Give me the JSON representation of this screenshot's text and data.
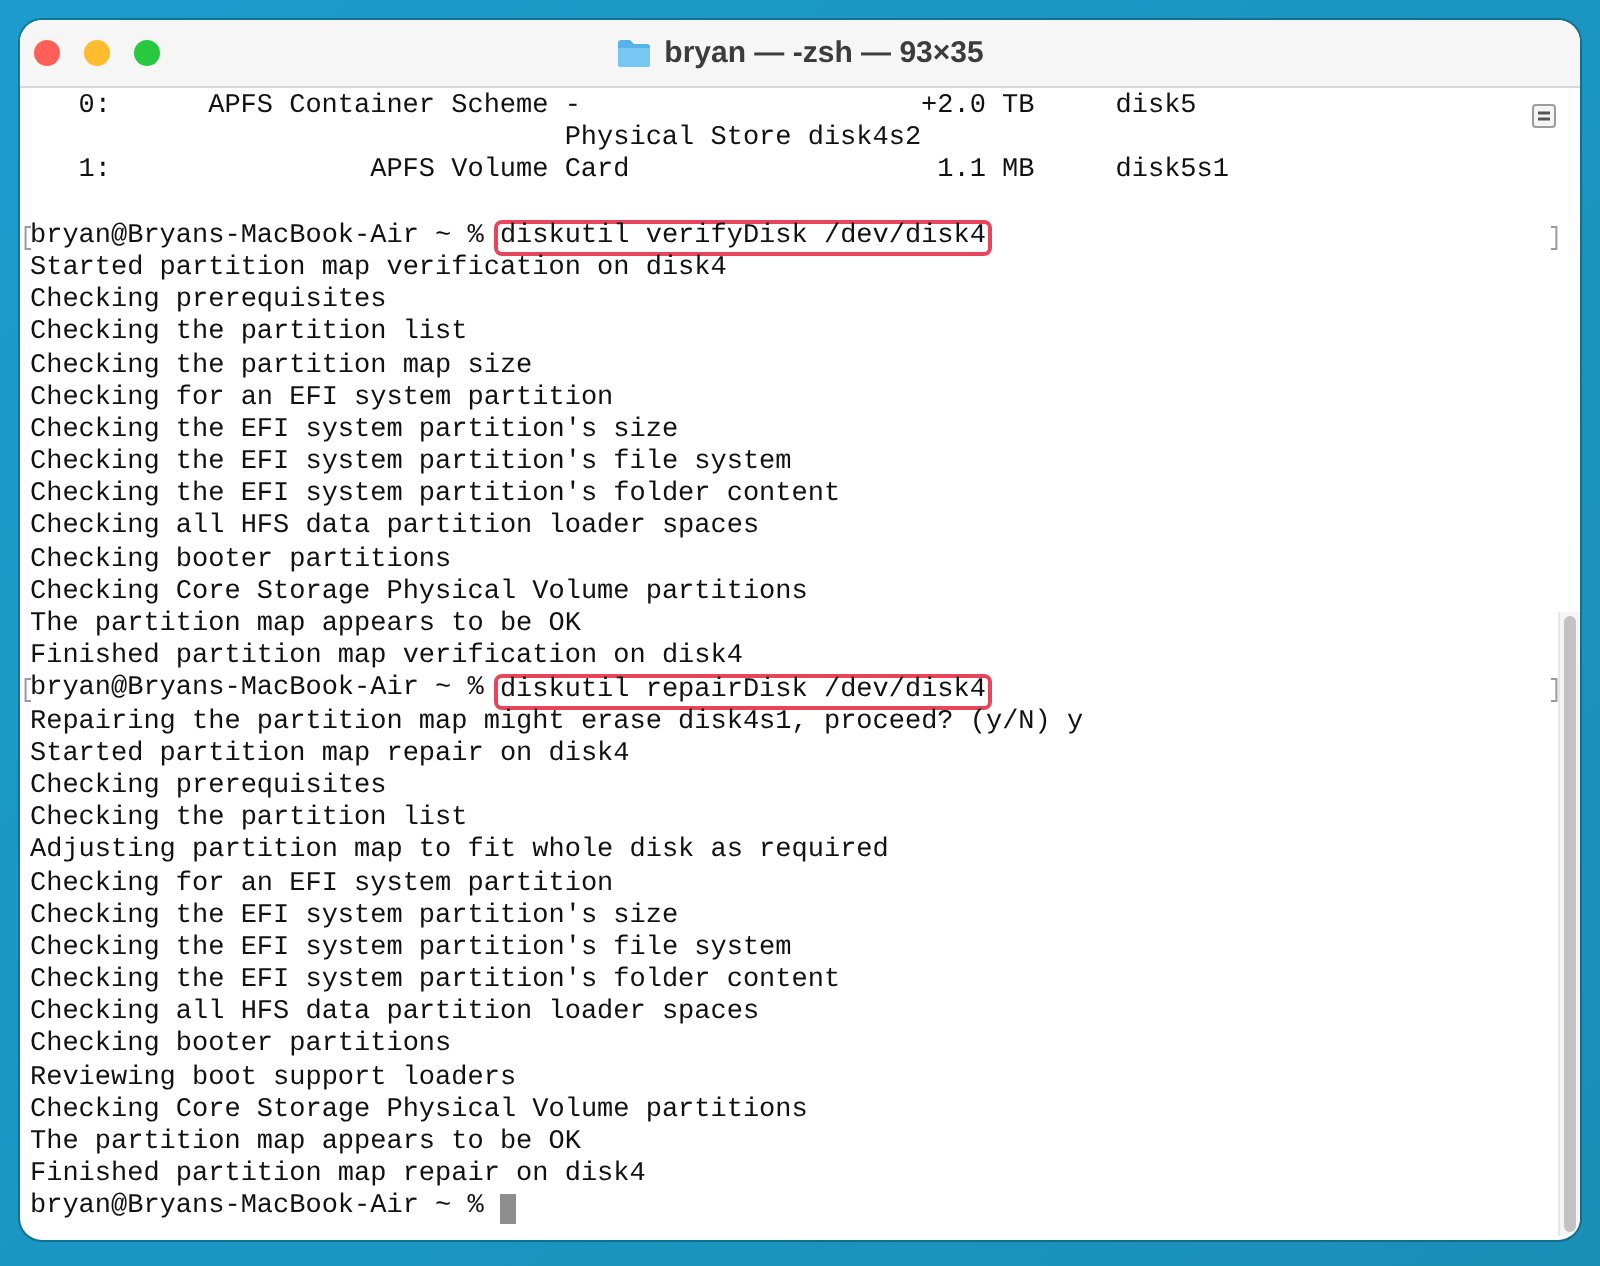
{
  "window": {
    "title": "bryan — -zsh — 93×35"
  },
  "disk_table": {
    "rows": [
      {
        "index": "0:",
        "type": "APFS Container Scheme",
        "name": "-",
        "name_more": "Physical Store disk4s2",
        "size": "+2.0 TB",
        "identifier": "disk5"
      },
      {
        "index": "1:",
        "type": "APFS Volume",
        "name": "Card",
        "size": "1.1 MB",
        "identifier": "disk5s1"
      }
    ]
  },
  "lines": [
    {
      "kind": "blank"
    },
    {
      "kind": "prompt",
      "prompt": "bryan@Bryans-MacBook-Air ~ %",
      "command": "diskutil verifyDisk /dev/disk4",
      "highlighted": true,
      "marked": true
    },
    {
      "kind": "output",
      "text": "Started partition map verification on disk4"
    },
    {
      "kind": "output",
      "text": "Checking prerequisites"
    },
    {
      "kind": "output",
      "text": "Checking the partition list"
    },
    {
      "kind": "output",
      "text": "Checking the partition map size"
    },
    {
      "kind": "output",
      "text": "Checking for an EFI system partition"
    },
    {
      "kind": "output",
      "text": "Checking the EFI system partition's size"
    },
    {
      "kind": "output",
      "text": "Checking the EFI system partition's file system"
    },
    {
      "kind": "output",
      "text": "Checking the EFI system partition's folder content"
    },
    {
      "kind": "output",
      "text": "Checking all HFS data partition loader spaces"
    },
    {
      "kind": "output",
      "text": "Checking booter partitions"
    },
    {
      "kind": "output",
      "text": "Checking Core Storage Physical Volume partitions"
    },
    {
      "kind": "output",
      "text": "The partition map appears to be OK"
    },
    {
      "kind": "output",
      "text": "Finished partition map verification on disk4"
    },
    {
      "kind": "prompt",
      "prompt": "bryan@Bryans-MacBook-Air ~ %",
      "command": "diskutil repairDisk /dev/disk4",
      "highlighted": true,
      "marked": true
    },
    {
      "kind": "output",
      "text": "Repairing the partition map might erase disk4s1, proceed? (y/N) y"
    },
    {
      "kind": "output",
      "text": "Started partition map repair on disk4"
    },
    {
      "kind": "output",
      "text": "Checking prerequisites"
    },
    {
      "kind": "output",
      "text": "Checking the partition list"
    },
    {
      "kind": "output",
      "text": "Adjusting partition map to fit whole disk as required"
    },
    {
      "kind": "output",
      "text": "Checking for an EFI system partition"
    },
    {
      "kind": "output",
      "text": "Checking the EFI system partition's size"
    },
    {
      "kind": "output",
      "text": "Checking the EFI system partition's file system"
    },
    {
      "kind": "output",
      "text": "Checking the EFI system partition's folder content"
    },
    {
      "kind": "output",
      "text": "Checking all HFS data partition loader spaces"
    },
    {
      "kind": "output",
      "text": "Checking booter partitions"
    },
    {
      "kind": "output",
      "text": "Reviewing boot support loaders"
    },
    {
      "kind": "output",
      "text": "Checking Core Storage Physical Volume partitions"
    },
    {
      "kind": "output",
      "text": "The partition map appears to be OK"
    },
    {
      "kind": "output",
      "text": "Finished partition map repair on disk4"
    },
    {
      "kind": "prompt",
      "prompt": "bryan@Bryans-MacBook-Air ~ %",
      "cursor": true
    }
  ]
}
